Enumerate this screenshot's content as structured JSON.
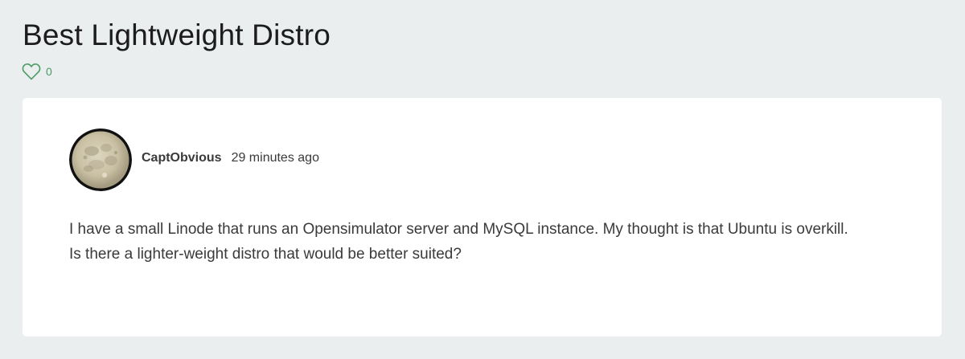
{
  "thread": {
    "title": "Best Lightweight Distro",
    "like_count": "0"
  },
  "post": {
    "author": "CaptObvious",
    "time_ago": "29 minutes ago",
    "body": "I have a small Linode that runs an Opensimulator server and MySQL instance. My thought is that Ubuntu is overkill. Is there a lighter-weight distro that would be better suited?"
  },
  "icons": {
    "like": "heart-outline-icon",
    "avatar": "moon-avatar-image"
  },
  "colors": {
    "page_background": "#eaeeef",
    "card_background": "#ffffff",
    "accent_green": "#4a9a62",
    "title_text": "#1c1c1c",
    "body_text": "#3a3a3a"
  }
}
